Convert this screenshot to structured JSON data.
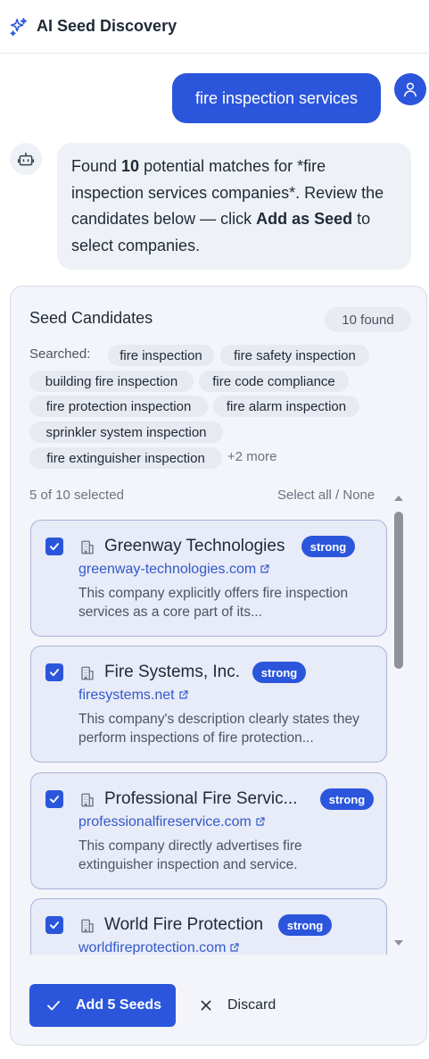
{
  "header": {
    "title": "AI Seed Discovery",
    "icon": "sparkles-icon"
  },
  "chat": {
    "user_message": "fire inspection services",
    "bot_message": {
      "p1": "Found ",
      "count": "10",
      "p2": " potential matches for *fire inspection services companies*. Review the candidates below — click ",
      "action": "Add as Seed",
      "p3": " to select companies."
    }
  },
  "panel": {
    "title": "Seed Candidates",
    "found": "10 found",
    "searched_label": "Searched:",
    "searched_terms": [
      "fire inspection",
      "fire safety inspection",
      "building fire inspection",
      "fire code compliance",
      "fire protection inspection",
      "fire alarm inspection",
      "sprinkler system inspection",
      "fire extinguisher inspection"
    ],
    "more": "+2 more",
    "selection_count": "5 of 10 selected",
    "select_all": "Select all / None",
    "candidates": [
      {
        "name": "Greenway Technologies",
        "badge": "strong",
        "domain": "greenway-technologies.com",
        "description": "This company explicitly offers fire inspection services as a core part of its...",
        "checked": true
      },
      {
        "name": "Fire Systems, Inc.",
        "badge": "strong",
        "domain": "firesystems.net",
        "description": "This company's description clearly states they perform inspections of fire protection...",
        "checked": true
      },
      {
        "name": "Professional Fire Servic...",
        "badge": "strong",
        "domain": "professionalfireservice.com",
        "description": "This company directly advertises fire extinguisher inspection and service.",
        "checked": true
      },
      {
        "name": "World Fire Protection",
        "badge": "strong",
        "domain": "worldfireprotection.com",
        "description": "",
        "checked": true
      }
    ],
    "add_button": "Add 5 Seeds",
    "discard_button": "Discard"
  },
  "colors": {
    "accent": "#2b56dc",
    "card_bg": "#e8ebf8",
    "panel_bg": "#f3f5fa",
    "link": "#3359c9"
  }
}
